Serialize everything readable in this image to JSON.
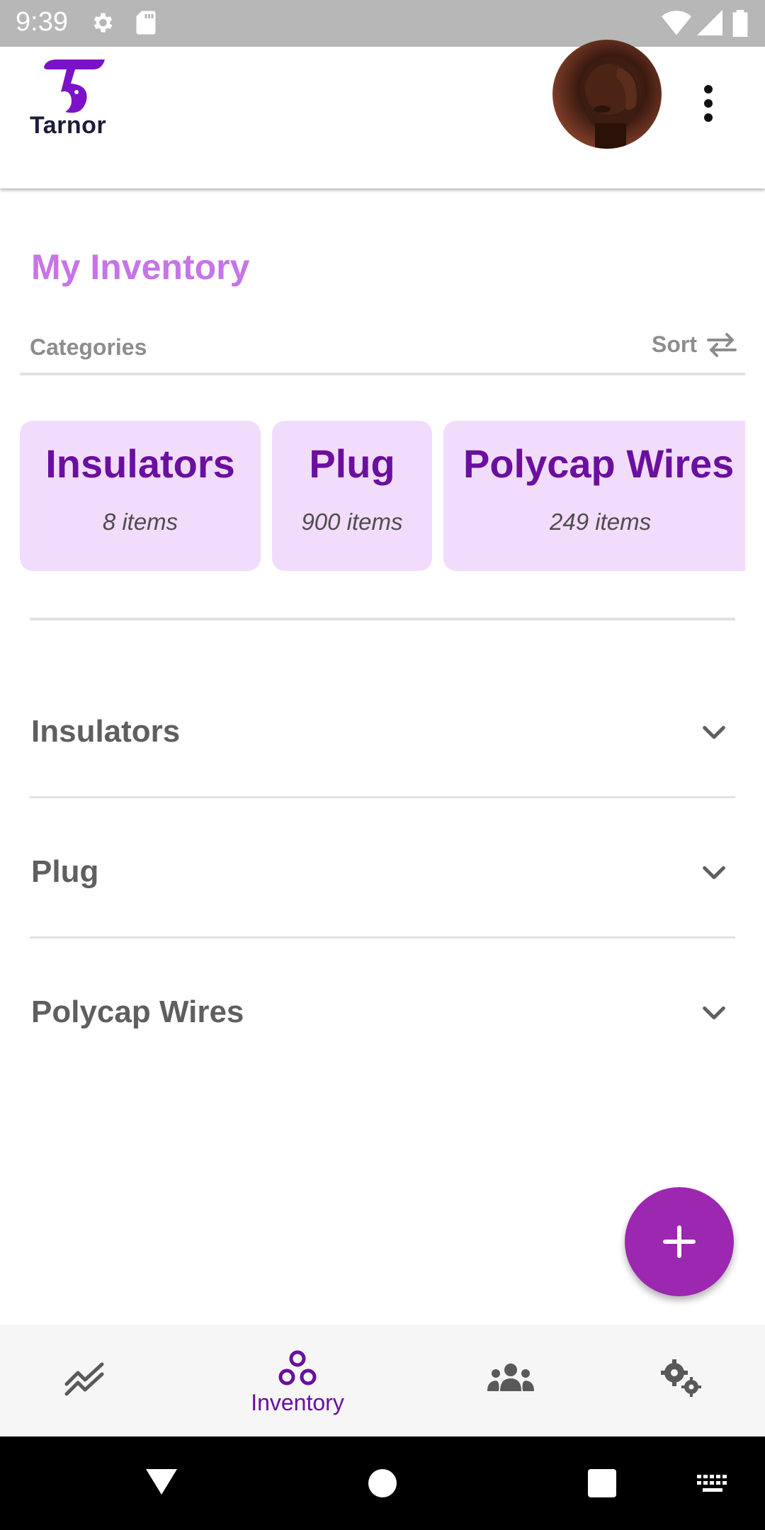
{
  "status_bar": {
    "time": "9:39",
    "icons": [
      "gear-icon",
      "sd-card-icon",
      "wifi-icon",
      "signal-icon",
      "battery-icon"
    ]
  },
  "app_bar": {
    "logo_text": "Tarnor",
    "avatar": "user-avatar",
    "menu_icon": "more-vert-icon"
  },
  "page": {
    "title": "My Inventory"
  },
  "categories": {
    "label": "Categories",
    "sort_label": "Sort"
  },
  "category_cards": [
    {
      "name": "Insulators",
      "count": "8 items"
    },
    {
      "name": "Plug",
      "count": "900 items"
    },
    {
      "name": "Polycap Wires",
      "count": "249 items"
    }
  ],
  "accordion": [
    {
      "title": "Insulators"
    },
    {
      "title": "Plug"
    },
    {
      "title": "Polycap Wires"
    }
  ],
  "bottom_nav": {
    "active_label": "Inventory",
    "items": [
      "trending-icon",
      "inventory-icon",
      "people-icon",
      "settings-icon"
    ]
  },
  "colors": {
    "accent": "#9c27b0",
    "title": "#c774e8",
    "card_bg": "#f2dcfb",
    "card_text": "#6a0f9e"
  }
}
